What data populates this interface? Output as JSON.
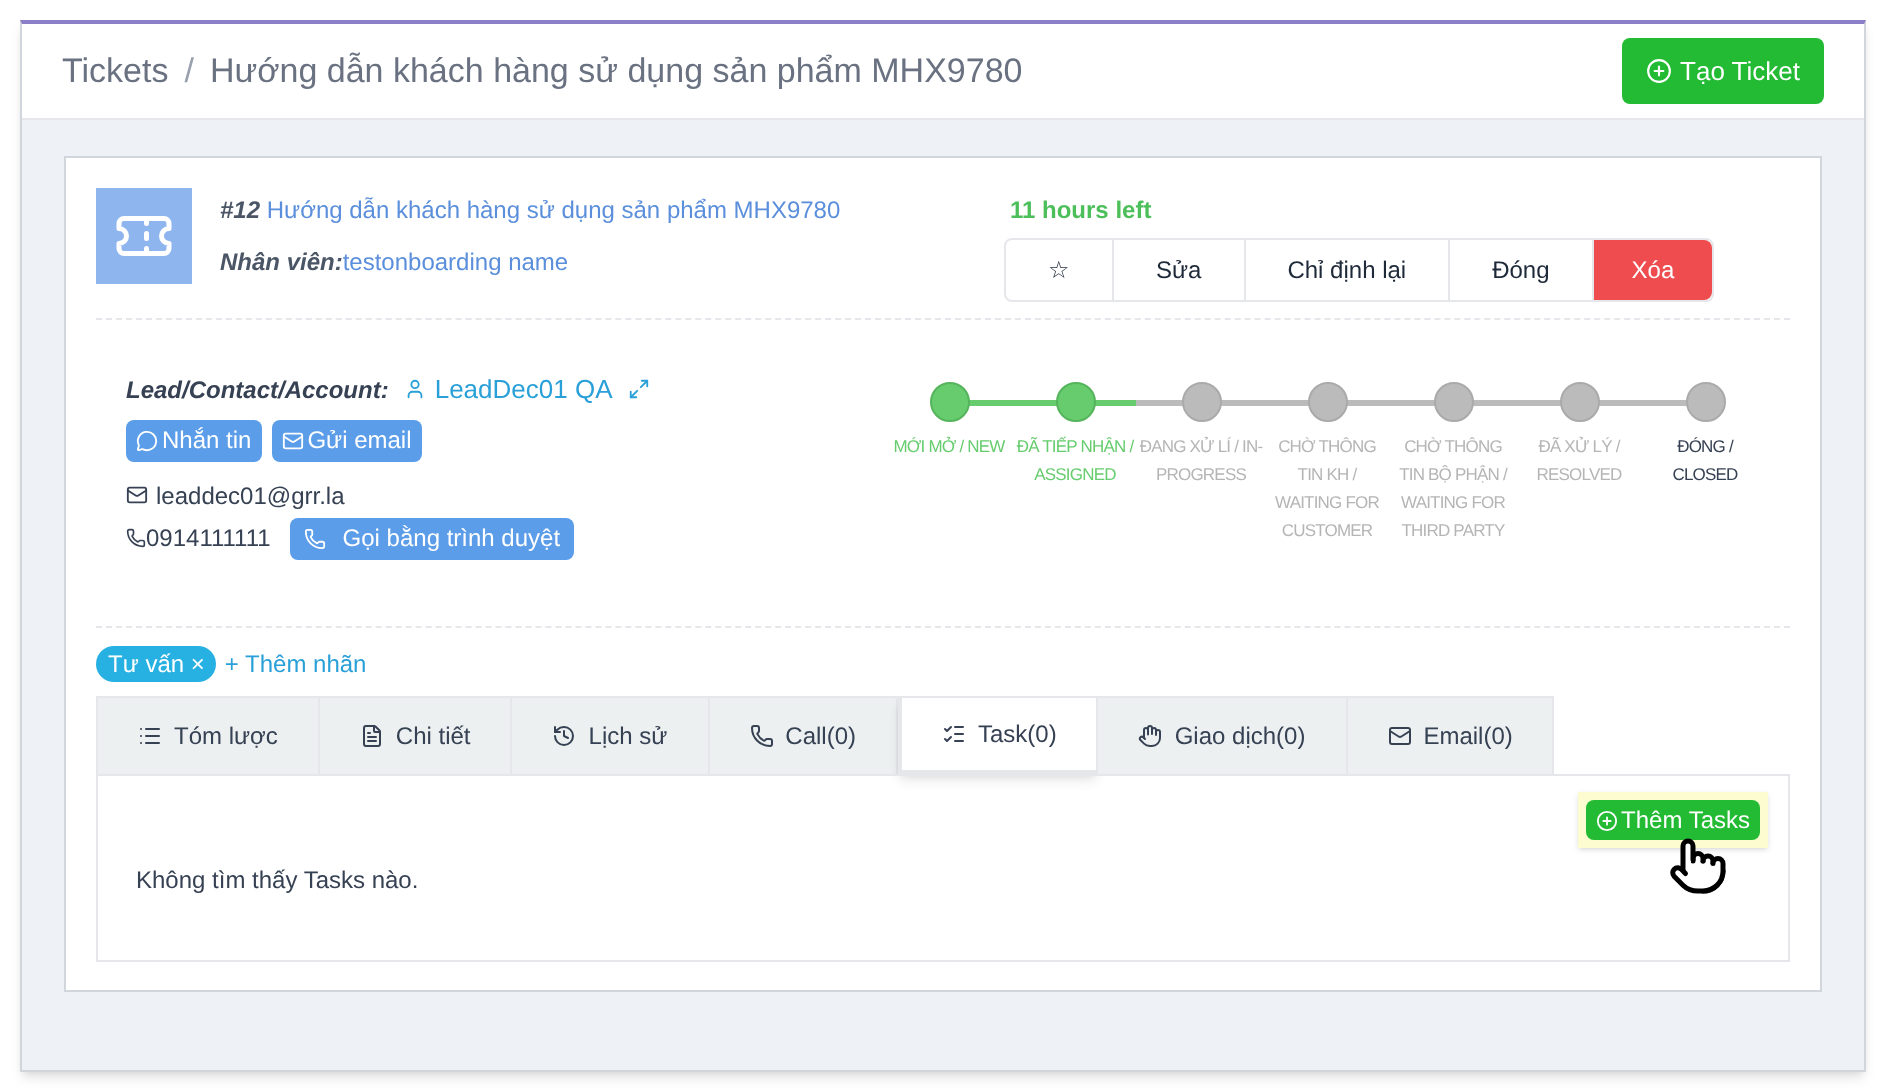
{
  "breadcrumb": [
    {
      "text": "Tickets",
      "separator": "/"
    },
    {
      "text": "Hướng dẫn khách hàng sử dụng sản phẩm MHX9780"
    }
  ],
  "create_button": "Tạo Ticket",
  "ticket": {
    "number": "#12",
    "title": "Hướng dẫn khách hàng sử dụng sản phẩm MHX9780",
    "staff_label": "Nhân viên:",
    "staff": "testonboarding name",
    "time_left": "11 hours left"
  },
  "actions": [
    {
      "label": "☆",
      "kind": "plain"
    },
    {
      "label": "Sửa",
      "kind": "plain"
    },
    {
      "label": "Chỉ định lại",
      "kind": "plain"
    },
    {
      "label": "Đóng",
      "kind": "plain"
    },
    {
      "label": "Xóa",
      "kind": "danger"
    }
  ],
  "contact": {
    "label": "Lead/Contact/Account:",
    "name": "LeadDec01 QA",
    "message_button": "Nhắn tin",
    "email_button": "Gửi email",
    "email": "leaddec01@grr.la",
    "phone": "0914111111",
    "call_button": "Gọi bằng trình duyệt"
  },
  "steps": [
    {
      "label": "MỚI MỞ / NEW",
      "kind": "done"
    },
    {
      "label": "ĐÃ TIẾP NHẬN / ASSIGNED",
      "kind": "done"
    },
    {
      "label": "ĐANG XỬ LÍ / IN-PROGRESS",
      "kind": "pending"
    },
    {
      "label": "CHỜ THÔNG TIN KH / WAITING FOR CUSTOMER",
      "kind": "pending"
    },
    {
      "label": "CHỜ THÔNG TIN BỘ PHẬN / WAITING FOR THIRD PARTY",
      "kind": "pending"
    },
    {
      "label": "ĐÃ XỬ LÝ / RESOLVED",
      "kind": "pending"
    },
    {
      "label": "ĐÓNG / CLOSED",
      "kind": "final"
    }
  ],
  "tags": [
    {
      "label": "Tư vấn",
      "remove": "×"
    }
  ],
  "add_tag": "+ Thêm nhãn",
  "tabs": [
    {
      "label": "Tóm lược",
      "selected": false
    },
    {
      "label": "Chi tiết",
      "selected": false
    },
    {
      "label": "Lịch sử",
      "selected": false
    },
    {
      "label": "Call(0)",
      "selected": false
    },
    {
      "label": "Task(0)",
      "selected": true
    },
    {
      "label": "Giao dịch(0)",
      "selected": false
    },
    {
      "label": "Email(0)",
      "selected": false
    }
  ],
  "add_task_button": "Thêm Tasks",
  "empty_message": "Không tìm thấy Tasks nào."
}
